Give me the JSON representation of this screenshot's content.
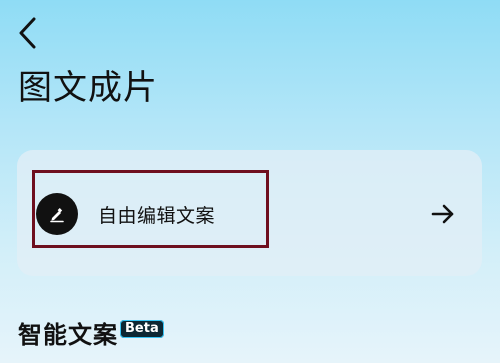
{
  "header": {
    "back_icon": "chevron-left-icon",
    "title": "图文成片"
  },
  "card": {
    "edit_icon": "pencil-icon",
    "edit_label": "自由编辑文案",
    "arrow_icon": "arrow-right-icon"
  },
  "section": {
    "title": "智能文案",
    "badge": "Beta"
  },
  "colors": {
    "highlight_border": "#6e0f1f",
    "badge_background": "#0e2733",
    "badge_outline": "#39c5f5"
  }
}
